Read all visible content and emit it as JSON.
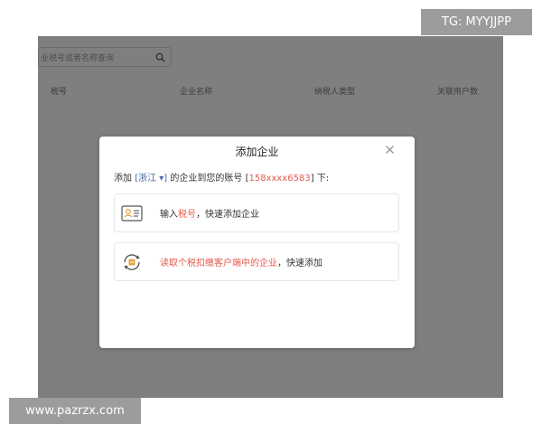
{
  "background": {
    "search": {
      "placeholder": "业税号或者名称查询",
      "icon": "search-icon"
    },
    "table_headers": [
      "税号",
      "企业名称",
      "纳税人类型",
      "关联用户数"
    ]
  },
  "modal": {
    "title": "添加企业",
    "close_icon": "close-icon",
    "subtitle": {
      "prefix": "添加 ",
      "region": "[浙江 ▾]",
      "middle": " 的企业到您的账号 ",
      "bracket_open": "[",
      "account": "158xxxx6583",
      "bracket_close": "]",
      "suffix": " 下:"
    },
    "options": [
      {
        "icon": "id-card-icon",
        "before": "输入",
        "highlight": "税号",
        "after": "，快速添加企业"
      },
      {
        "icon": "tax-client-icon",
        "highlight": "读取个税扣缴客户端中的企业",
        "after": "，快速添加"
      }
    ]
  },
  "watermarks": {
    "top": "TG: MYYJJPP",
    "bottom": "www.pazrzx.com"
  },
  "colors": {
    "accent_red": "#e45b4f",
    "accent_blue": "#4a6aa8",
    "overlay": "rgba(0,0,0,0.5)",
    "icon_orange": "#e8a33d"
  }
}
